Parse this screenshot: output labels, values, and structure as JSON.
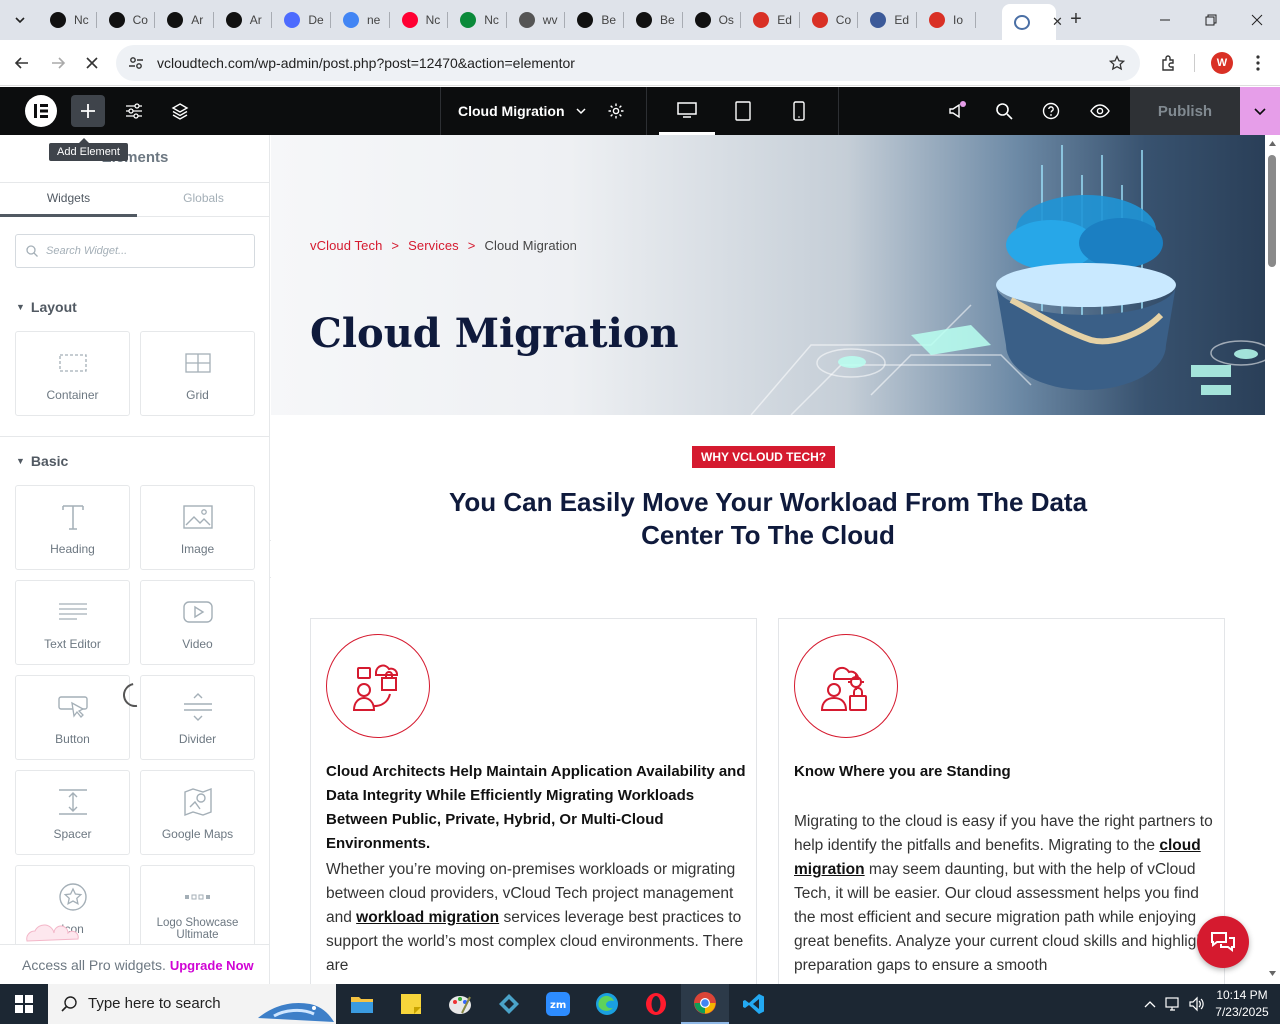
{
  "browser": {
    "tabs": [
      {
        "label": "Nc",
        "icon": "openai-icon",
        "color": "#111111"
      },
      {
        "label": "Co",
        "icon": "openai-icon",
        "color": "#111111"
      },
      {
        "label": "Ar",
        "icon": "openai-icon",
        "color": "#111111"
      },
      {
        "label": "Ar",
        "icon": "openai-icon",
        "color": "#111111"
      },
      {
        "label": "De",
        "icon": "deepseek-icon",
        "color": "#4d6bfe"
      },
      {
        "label": "ne",
        "icon": "google-icon",
        "color": "#4285f4"
      },
      {
        "label": "Nc",
        "icon": "youtube-icon",
        "color": "#ff0033"
      },
      {
        "label": "Nc",
        "icon": "webflow-icon",
        "color": "#0b8a3a"
      },
      {
        "label": "wv",
        "icon": "linkedin-icon",
        "color": "#555555"
      },
      {
        "label": "Be",
        "icon": "x-icon",
        "color": "#111111"
      },
      {
        "label": "Be",
        "icon": "x-icon",
        "color": "#111111"
      },
      {
        "label": "Os",
        "icon": "spark-icon",
        "color": "#111111"
      },
      {
        "label": "Ed",
        "icon": "tag-icon",
        "color": "#d93025"
      },
      {
        "label": "Co",
        "icon": "tag-icon",
        "color": "#d93025"
      },
      {
        "label": "Ed",
        "icon": "g-icon",
        "color": "#3c5a99"
      },
      {
        "label": "Io",
        "icon": "tag-icon",
        "color": "#d93025"
      }
    ],
    "url": "vcloudtech.com/wp-admin/post.php?post=12470&action=elementor",
    "profile_initial": "W"
  },
  "editor": {
    "add_element_tooltip": "Add Element",
    "document_title": "Cloud Migration",
    "publish_label": "Publish"
  },
  "panel": {
    "title": "Elements",
    "tabs": [
      "Widgets",
      "Globals"
    ],
    "search_placeholder": "Search Widget...",
    "categories": {
      "layout": "Layout",
      "basic": "Basic"
    },
    "layout_widgets": [
      "Container",
      "Grid"
    ],
    "basic_widgets": [
      "Heading",
      "Image",
      "Text Editor",
      "Video",
      "Button",
      "Divider",
      "Spacer",
      "Google Maps",
      "Icon",
      "Logo Showcase Ultimate"
    ],
    "pro_text": "Access all Pro widgets.",
    "pro_link": "Upgrade Now"
  },
  "page": {
    "breadcrumb": [
      "vCloud Tech",
      ">",
      "Services",
      ">",
      "Cloud Migration"
    ],
    "hero_title": "Cloud Migration",
    "badge": "WHY VCLOUD TECH?",
    "headline": "You Can Easily Move Your Workload From The Data Center To The Cloud",
    "card1": {
      "heading": "Cloud Architects Help Maintain Application Availability and Data Integrity While Efficiently Migrating Workloads Between Public, Private, Hybrid, Or Multi-Cloud Environments.",
      "p1": "Whether you’re moving on-premises workloads or migrating between cloud providers, vCloud Tech project management and ",
      "link": "workload migration",
      "p2": " services leverage best practices to support the world’s most complex cloud environments. There are"
    },
    "card2": {
      "heading": "Know Where you are Standing",
      "p1": "Migrating to the cloud is easy if you have the right partners to help identify the pitfalls and benefits. Migrating to the ",
      "link": "cloud migration",
      "p2": " may seem daunting, but with the help of vCloud Tech, it will be easier. Our cloud assessment helps you find the most efficient and secure migration path while enjoying great benefits. Analyze your current cloud skills and highlight preparation gaps to ensure a smooth"
    },
    "accent_color": "#d51a2f",
    "navy_color": "#0f1a3c"
  },
  "taskbar": {
    "search_placeholder": "Type here to search",
    "time": "10:14 PM",
    "date": "7/23/2025"
  }
}
